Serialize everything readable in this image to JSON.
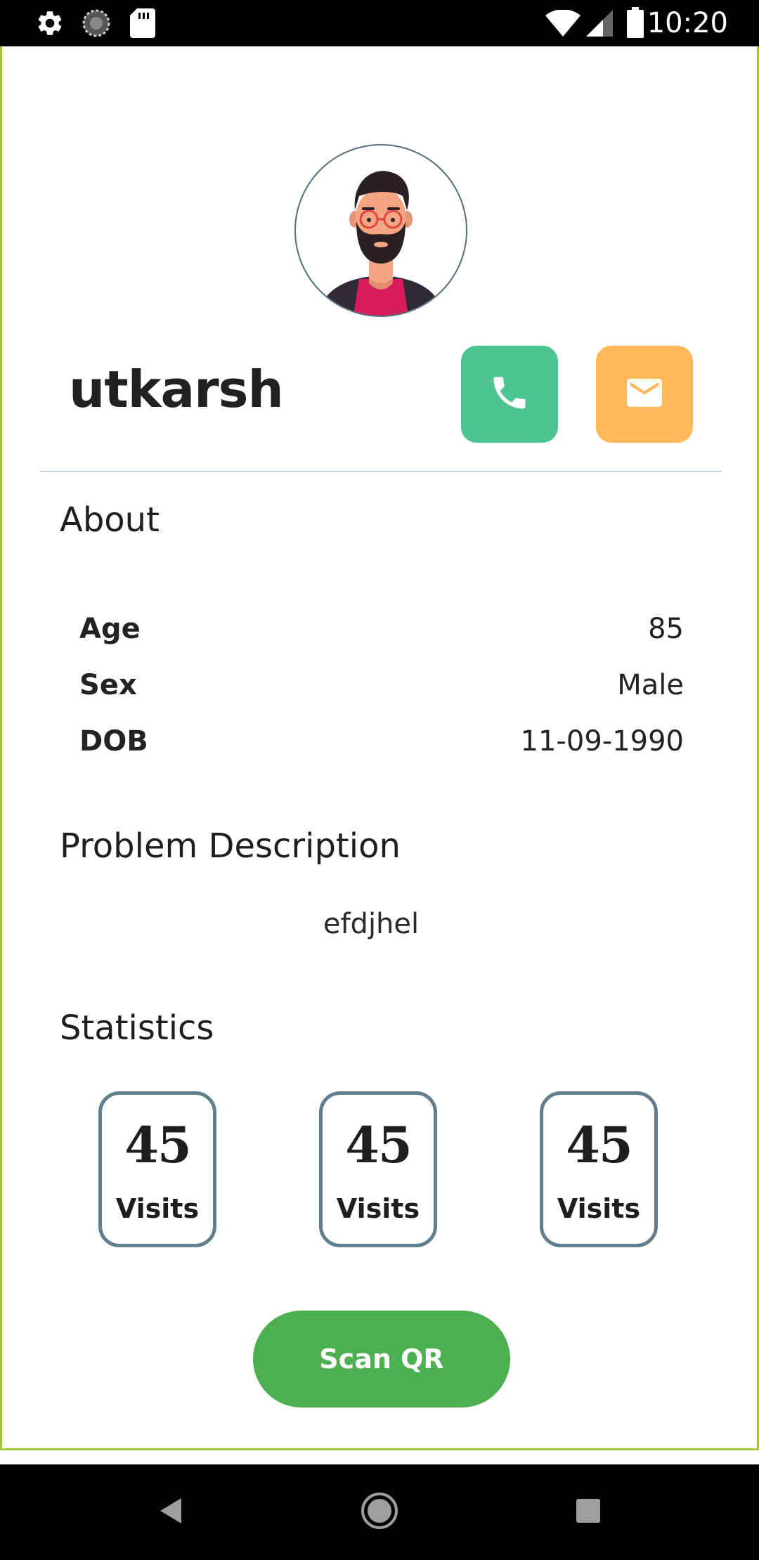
{
  "status_bar": {
    "time": "10:20",
    "left_icons": [
      "settings-icon",
      "sync-icon",
      "sd-card-icon"
    ],
    "right_icons": [
      "wifi-icon",
      "signal-icon",
      "battery-icon"
    ]
  },
  "profile": {
    "name": "utkarsh",
    "avatar_icon": "avatar-man-beard-glasses",
    "actions": [
      {
        "name": "call",
        "icon": "phone-icon",
        "color": "#4dc591"
      },
      {
        "name": "email",
        "icon": "mail-icon",
        "color": "#ffb95a"
      }
    ]
  },
  "about": {
    "title": "About",
    "rows": [
      {
        "label": "Age",
        "value": "85"
      },
      {
        "label": "Sex",
        "value": "Male"
      },
      {
        "label": "DOB",
        "value": "11-09-1990"
      }
    ]
  },
  "problem": {
    "title": "Problem Description",
    "text": "efdjhel"
  },
  "statistics": {
    "title": "Statistics",
    "items": [
      {
        "value": "45",
        "label": "Visits"
      },
      {
        "value": "45",
        "label": "Visits"
      },
      {
        "value": "45",
        "label": "Visits"
      }
    ]
  },
  "scan_button": {
    "label": "Scan QR",
    "color": "#4caf50"
  },
  "nav_bar": {
    "buttons": [
      "back-icon",
      "home-icon",
      "recents-icon"
    ]
  }
}
